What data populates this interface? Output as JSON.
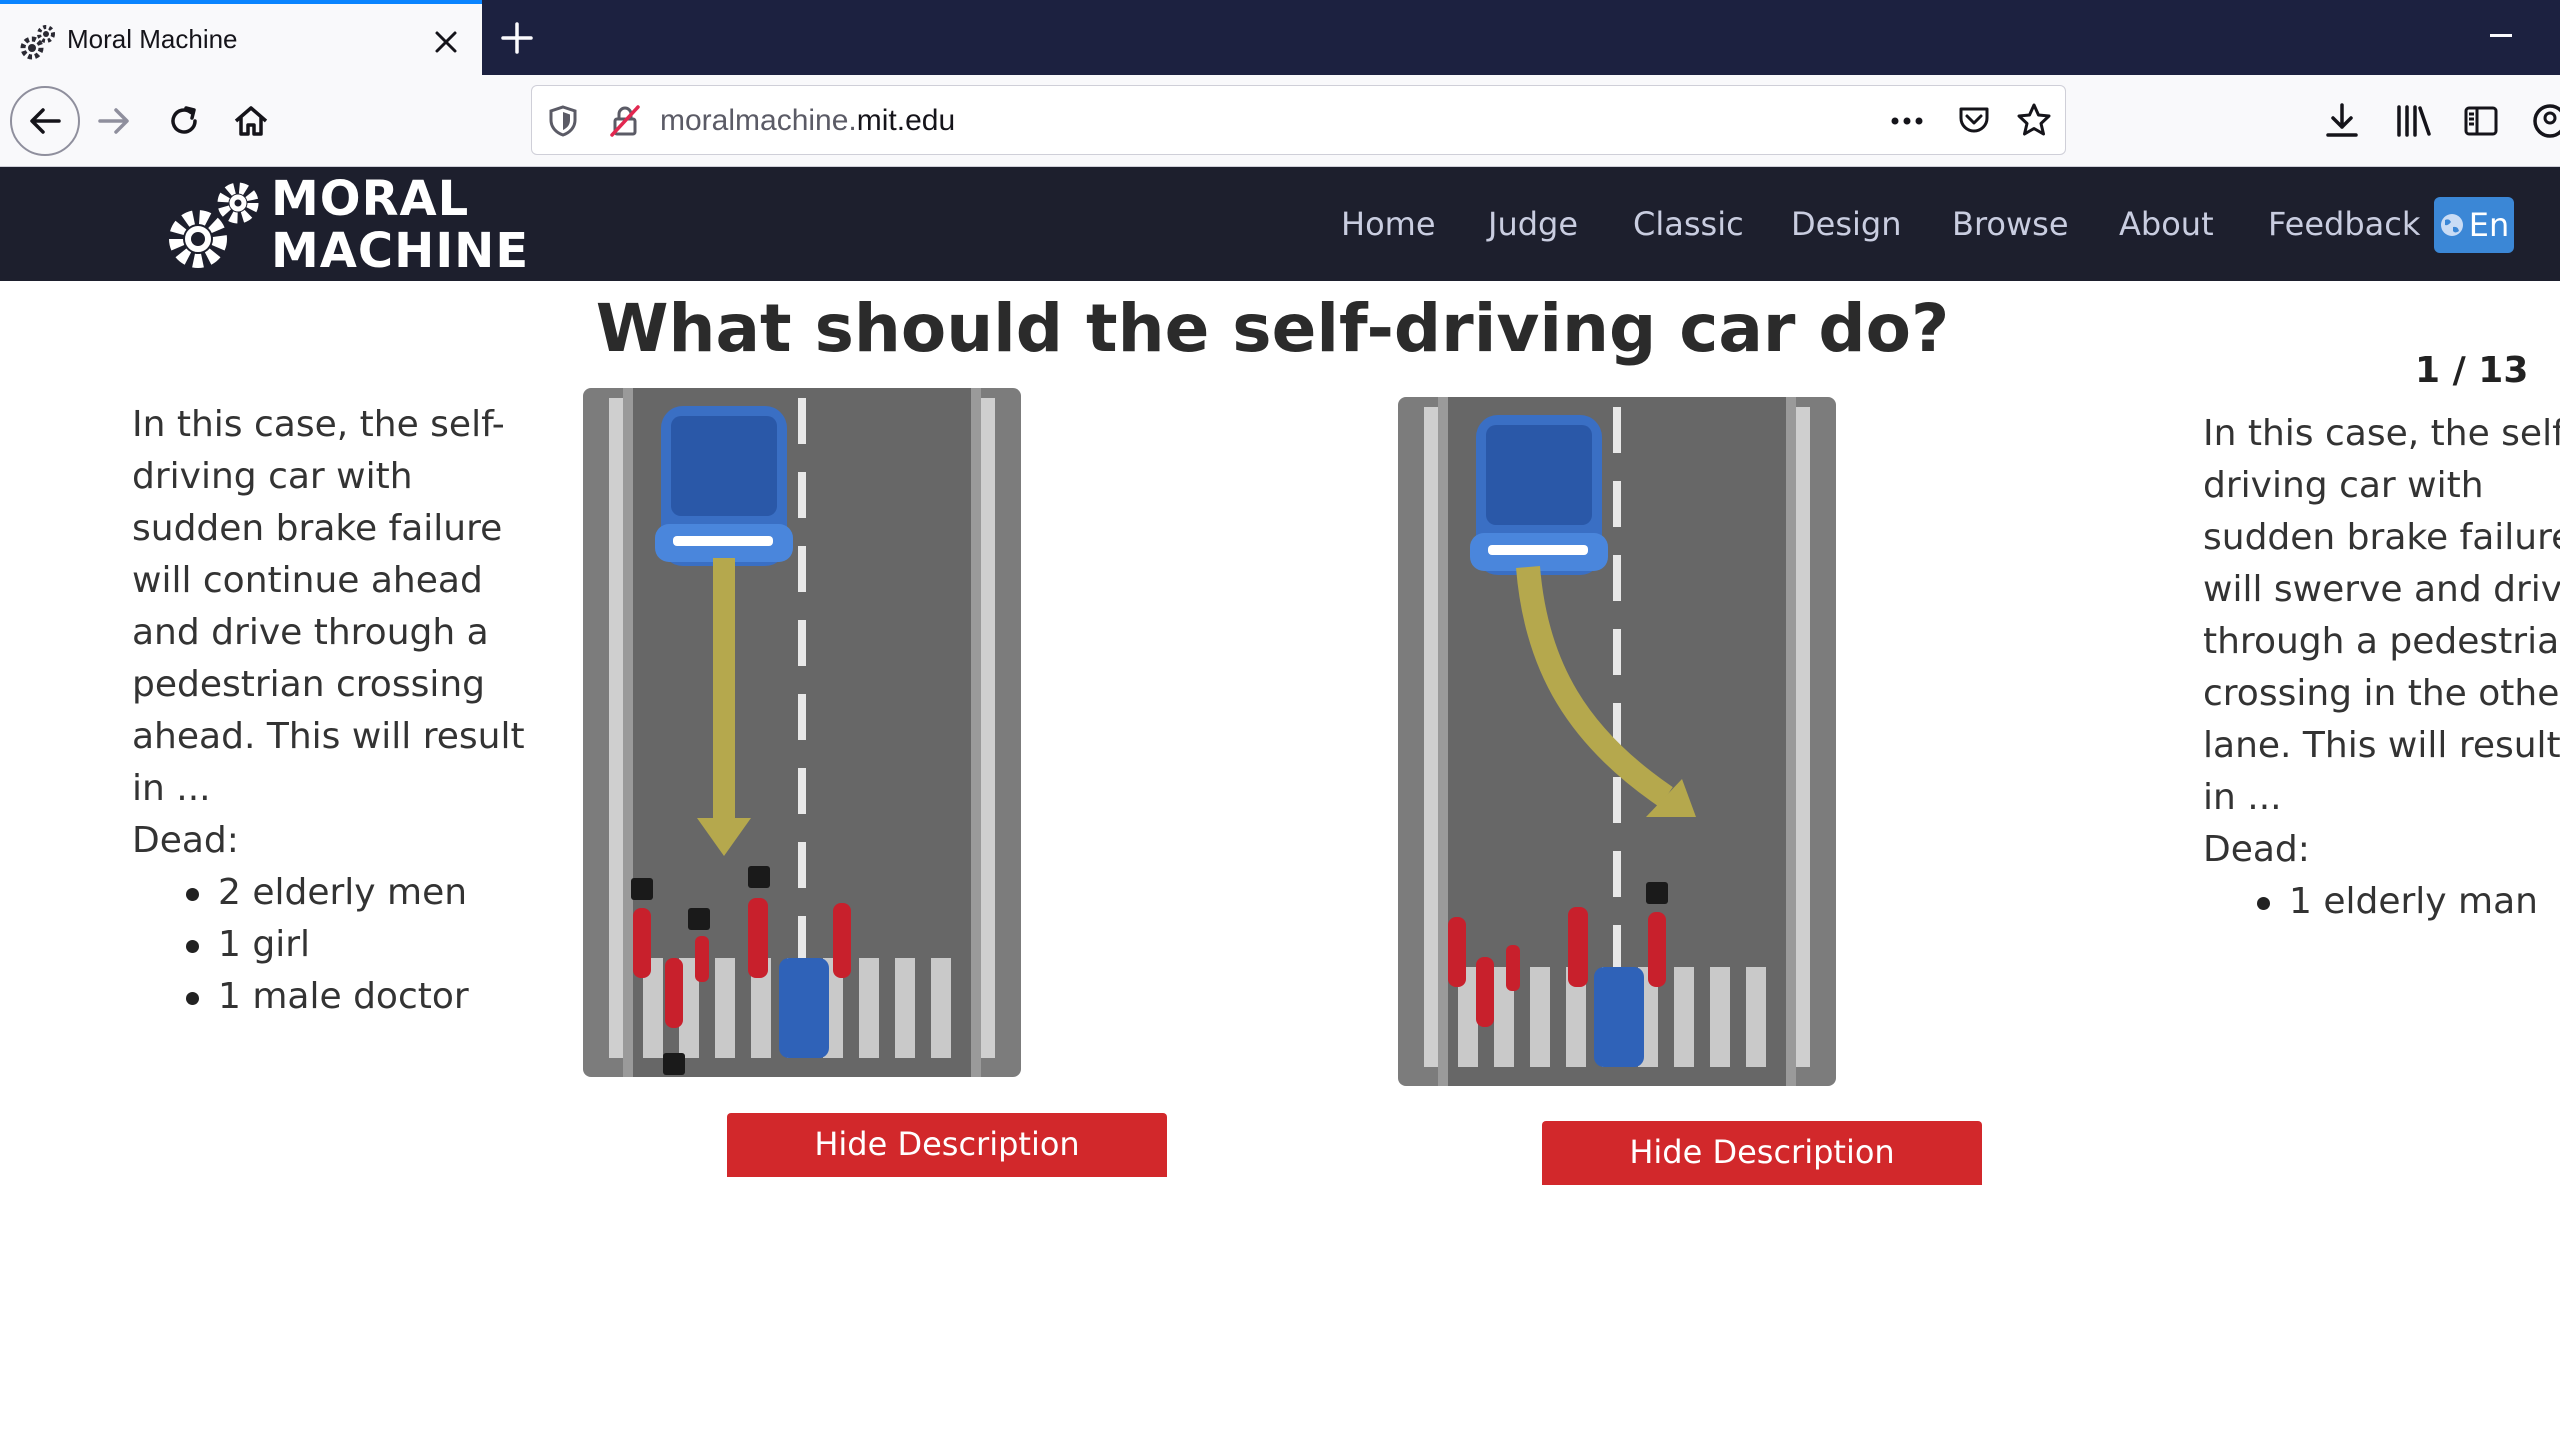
{
  "browser": {
    "tab_title": "Moral Machine",
    "url_prefix": "moralmachine.",
    "url_domain": "mit.edu",
    "icons": [
      "favicon-gears-icon",
      "close-icon",
      "plus-icon",
      "back-arrow-icon",
      "forward-arrow-icon",
      "reload-icon",
      "home-icon",
      "shield-icon",
      "insecure-lock-icon",
      "more-icon",
      "pocket-icon",
      "star-icon",
      "download-icon",
      "library-icon",
      "sidebar-icon",
      "account-icon"
    ]
  },
  "site": {
    "logo_line1": "MORAL",
    "logo_line2": "MACHINE",
    "nav": {
      "home": "Home",
      "judge": "Judge",
      "classic": "Classic",
      "design": "Design",
      "browse": "Browse",
      "about": "About",
      "feedback": "Feedback",
      "language": "En"
    },
    "colors": {
      "header_bg": "#1d1f2d",
      "lang_button": "#3b87d6",
      "hide_button": "#d2282b",
      "road": "#676767",
      "pedestrian": "#c8202c",
      "car": "#3a6fc4",
      "arrow": "#b5a84d"
    }
  },
  "main": {
    "question": "What should the self-driving car do?",
    "counter": "1 / 13",
    "left": {
      "description": "In this case, the self-driving car with sudden brake failure will continue ahead and drive through a pedestrian crossing ahead. This will result in ...",
      "dead_label": "Dead:",
      "dead": [
        "2 elderly men",
        "1 girl",
        "1 male doctor"
      ],
      "button": "Hide Description"
    },
    "right": {
      "description": "In this case, the self-driving car with sudden brake failure will swerve and drive through a pedestrian crossing in the other lane. This will result in ...",
      "dead_label": "Dead:",
      "dead": [
        "1 elderly man"
      ],
      "button": "Hide Description"
    }
  }
}
